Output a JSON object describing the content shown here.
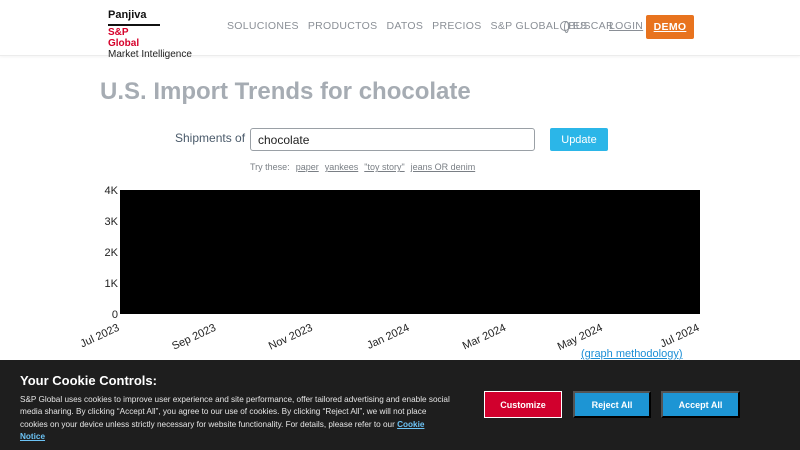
{
  "brand": {
    "line1": "Panjiva",
    "line2": "S&P Global",
    "line3": "Market Intelligence"
  },
  "nav": {
    "items": [
      "SOLUCIONES",
      "PRODUCTOS",
      "DATOS",
      "PRECIOS",
      "S&P GLOBAL",
      "BUSCAR"
    ],
    "lang": "ES",
    "login": "LOGIN",
    "demo": "DEMO"
  },
  "page": {
    "title": "U.S. Import Trends for chocolate"
  },
  "search": {
    "label": "Shipments of",
    "value": "chocolate",
    "button": "Update",
    "try_label": "Try these:",
    "examples": [
      "paper",
      "yankees",
      "\"toy story\"",
      "jeans OR denim"
    ]
  },
  "chart_data": {
    "type": "area",
    "x": [
      "Jul 2023",
      "Sep 2023",
      "Nov 2023",
      "Jan 2024",
      "Mar 2024",
      "May 2024",
      "Jul 2024"
    ],
    "yticks": [
      "0",
      "1K",
      "2K",
      "3K",
      "4K"
    ],
    "ylim": [
      0,
      4000
    ],
    "fill": "#000000",
    "link": "(graph methodology)"
  },
  "cookie": {
    "title": "Your Cookie Controls:",
    "text": "S&P Global uses cookies to improve user experience and site performance, offer tailored advertising and enable social media sharing. By clicking “Accept All”, you agree to our use of cookies. By clicking “Reject All”, we will not place cookies on your device unless strictly necessary for website functionality. For details, please refer to our",
    "link": "Cookie Notice",
    "customize": "Customize",
    "reject": "Reject All",
    "accept": "Accept All"
  }
}
